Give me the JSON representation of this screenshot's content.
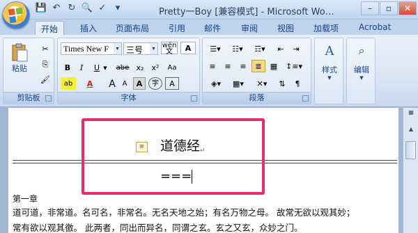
{
  "titlebar": {
    "title": "Pretty一Boy [兼容模式] - Microsoft Wo…",
    "qat_icons": [
      "save-icon",
      "undo-icon",
      "redo-icon",
      "print-preview-icon",
      "spelling-icon",
      "customize-icon"
    ],
    "window_controls": [
      "–",
      "▫",
      "✕"
    ]
  },
  "tabs": [
    "开始",
    "插入",
    "页面布局",
    "引用",
    "邮件",
    "审阅",
    "视图",
    "加载项",
    "Acrobat"
  ],
  "ribbon": {
    "clipboard": {
      "label": "剪贴板",
      "paste": "粘贴"
    },
    "font": {
      "label": "字体",
      "font_name": "Times New F",
      "font_size": "三号",
      "wen": "wén",
      "bold": "B",
      "italic": "I",
      "underline": "U",
      "strike": "abe",
      "subscript": "x₂",
      "superscript": "x²",
      "clear": "Aa",
      "highlight": "ab",
      "font_color": "A",
      "grow": "A",
      "shrink": "A",
      "aa": "Aa",
      "char_border": "A"
    },
    "paragraph": {
      "label": "段落"
    },
    "styles": {
      "label": "样式"
    },
    "editing": {
      "label": "编辑"
    }
  },
  "document": {
    "heading": "道德经",
    "equals": "===",
    "chapter": "第一章",
    "line1": "道可道，非常道。名可名，非常名。无名天地之始；有名万物之母。 故常无欲以观其妙；",
    "line2": "常有欲以观其徼。 此两者，同出而异名，同谓之玄。玄之又玄，众妙之门。",
    "para_mark": "↵"
  },
  "colors": {
    "highlight_box": "#e3306a",
    "ribbon_text": "#15428b"
  }
}
